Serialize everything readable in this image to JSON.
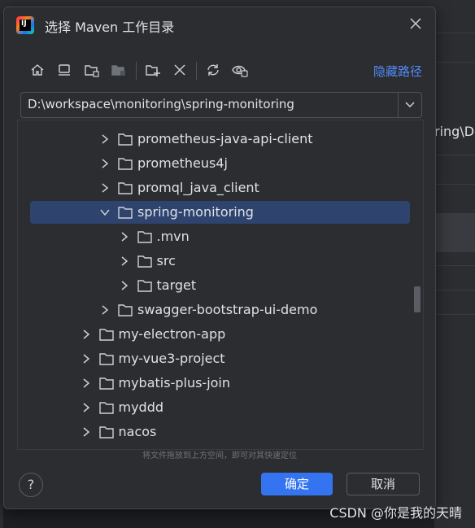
{
  "dialog": {
    "title": "选择 Maven 工作目录",
    "hide_path_label": "隐藏路径",
    "path_value": "D:\\workspace\\monitoring\\spring-monitoring",
    "drag_hint": "将文件拖放到上方空间，即可对其快速定位",
    "ok_label": "确定",
    "cancel_label": "取消",
    "help_label": "?"
  },
  "toolbar": {
    "icons": [
      "home-icon",
      "desktop-icon",
      "project-folder-icon",
      "module-folder-icon",
      "new-folder-icon",
      "delete-icon",
      "refresh-icon",
      "show-hidden-icon"
    ]
  },
  "tree": {
    "rows": [
      {
        "label": "prometheus-java-api-client",
        "level": 2,
        "expanded": false,
        "selected": false
      },
      {
        "label": "prometheus4j",
        "level": 2,
        "expanded": false,
        "selected": false
      },
      {
        "label": "promql_java_client",
        "level": 2,
        "expanded": false,
        "selected": false
      },
      {
        "label": "spring-monitoring",
        "level": 2,
        "expanded": true,
        "selected": true
      },
      {
        "label": ".mvn",
        "level": 3,
        "expanded": false,
        "selected": false
      },
      {
        "label": "src",
        "level": 3,
        "expanded": false,
        "selected": false
      },
      {
        "label": "target",
        "level": 3,
        "expanded": false,
        "selected": false
      },
      {
        "label": "swagger-bootstrap-ui-demo",
        "level": 2,
        "expanded": false,
        "selected": false
      },
      {
        "label": "my-electron-app",
        "level": 1,
        "expanded": false,
        "selected": false
      },
      {
        "label": "my-vue3-project",
        "level": 1,
        "expanded": false,
        "selected": false
      },
      {
        "label": "mybatis-plus-join",
        "level": 1,
        "expanded": false,
        "selected": false
      },
      {
        "label": "myddd",
        "level": 1,
        "expanded": false,
        "selected": false
      },
      {
        "label": "nacos",
        "level": 1,
        "expanded": false,
        "selected": false
      }
    ]
  },
  "background": {
    "fragment_text": "ring\\Do",
    "watermark": "CSDN @你是我的天晴"
  },
  "colors": {
    "dialog_bg": "#2b2d30",
    "selection": "#2e436e",
    "accent_link": "#548af7",
    "primary_button": "#3574f0"
  }
}
